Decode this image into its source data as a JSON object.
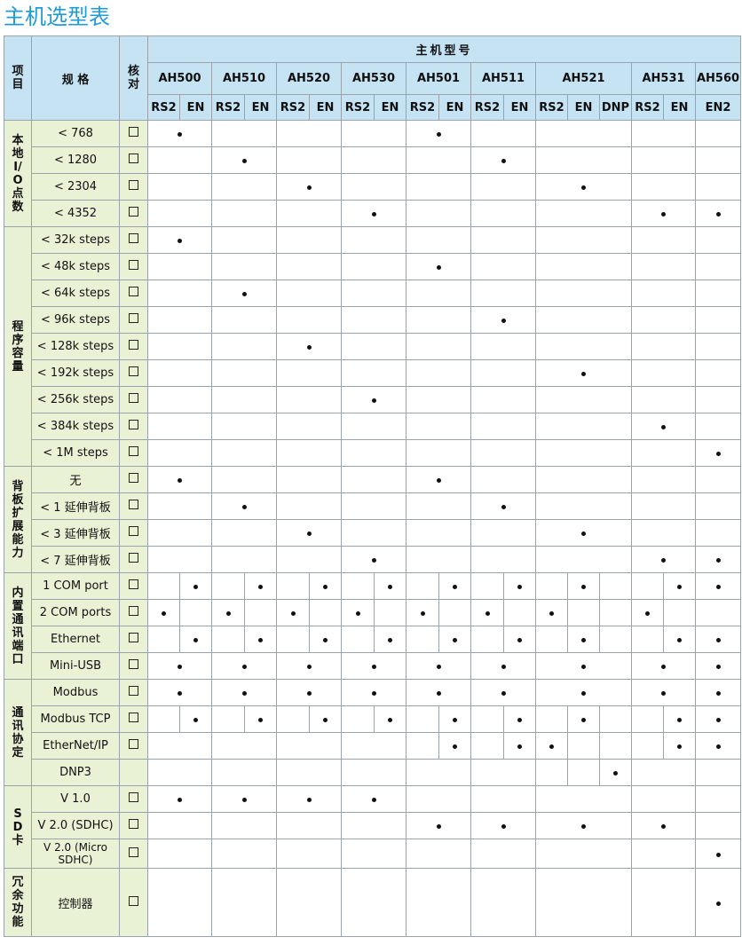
{
  "title": "主机选型表",
  "header": {
    "item": "项目",
    "spec": "规 格",
    "check": "核对",
    "models_title": "主机型号",
    "models": [
      "AH500",
      "AH510",
      "AH520",
      "AH530",
      "AH501",
      "AH511",
      "AH521",
      "AH531",
      "AH560"
    ]
  },
  "sub_columns": [
    "RS2",
    "EN",
    "RS2",
    "EN",
    "RS2",
    "EN",
    "RS2",
    "EN",
    "RS2",
    "EN",
    "RS2",
    "EN",
    "RS2",
    "EN",
    "DNP",
    "RS2",
    "EN",
    "EN2"
  ],
  "categories": [
    {
      "label": "本地I/O点数",
      "rows": [
        {
          "spec": "< 768",
          "checkbox": true,
          "marks": [
            1,
            0,
            0,
            0,
            0,
            0,
            0,
            0,
            1,
            0,
            0,
            0,
            0,
            0,
            0,
            0,
            0,
            0
          ]
        },
        {
          "spec": "< 1280",
          "checkbox": true,
          "marks": [
            0,
            0,
            1,
            0,
            0,
            0,
            0,
            0,
            0,
            0,
            1,
            0,
            0,
            0,
            0,
            0,
            0,
            0
          ]
        },
        {
          "spec": "< 2304",
          "checkbox": true,
          "marks": [
            0,
            0,
            0,
            0,
            1,
            0,
            0,
            0,
            0,
            0,
            0,
            0,
            1,
            0,
            0,
            0,
            0,
            0
          ]
        },
        {
          "spec": "< 4352",
          "checkbox": true,
          "marks": [
            0,
            0,
            0,
            0,
            0,
            0,
            1,
            0,
            0,
            0,
            0,
            0,
            0,
            0,
            0,
            1,
            0,
            1
          ]
        }
      ]
    },
    {
      "label": "程序容量",
      "rows": [
        {
          "spec": "< 32k steps",
          "checkbox": true,
          "marks": [
            1,
            0,
            0,
            0,
            0,
            0,
            0,
            0,
            0,
            0,
            0,
            0,
            0,
            0,
            0,
            0,
            0,
            0
          ]
        },
        {
          "spec": "< 48k steps",
          "checkbox": true,
          "marks": [
            0,
            0,
            0,
            0,
            0,
            0,
            0,
            0,
            1,
            0,
            0,
            0,
            0,
            0,
            0,
            0,
            0,
            0
          ]
        },
        {
          "spec": "< 64k steps",
          "checkbox": true,
          "marks": [
            0,
            0,
            1,
            0,
            0,
            0,
            0,
            0,
            0,
            0,
            0,
            0,
            0,
            0,
            0,
            0,
            0,
            0
          ]
        },
        {
          "spec": "< 96k steps",
          "checkbox": true,
          "marks": [
            0,
            0,
            0,
            0,
            0,
            0,
            0,
            0,
            0,
            0,
            1,
            0,
            0,
            0,
            0,
            0,
            0,
            0
          ]
        },
        {
          "spec": "< 128k steps",
          "checkbox": true,
          "marks": [
            0,
            0,
            0,
            0,
            1,
            0,
            0,
            0,
            0,
            0,
            0,
            0,
            0,
            0,
            0,
            0,
            0,
            0
          ]
        },
        {
          "spec": "< 192k steps",
          "checkbox": true,
          "marks": [
            0,
            0,
            0,
            0,
            0,
            0,
            0,
            0,
            0,
            0,
            0,
            0,
            1,
            0,
            0,
            0,
            0,
            0
          ]
        },
        {
          "spec": "< 256k steps",
          "checkbox": true,
          "marks": [
            0,
            0,
            0,
            0,
            0,
            0,
            1,
            0,
            0,
            0,
            0,
            0,
            0,
            0,
            0,
            0,
            0,
            0
          ]
        },
        {
          "spec": "< 384k steps",
          "checkbox": true,
          "marks": [
            0,
            0,
            0,
            0,
            0,
            0,
            0,
            0,
            0,
            0,
            0,
            0,
            0,
            0,
            0,
            1,
            0,
            0
          ]
        },
        {
          "spec": "< 1M steps",
          "checkbox": true,
          "marks": [
            0,
            0,
            0,
            0,
            0,
            0,
            0,
            0,
            0,
            0,
            0,
            0,
            0,
            0,
            0,
            0,
            0,
            1
          ]
        }
      ]
    },
    {
      "label": "背板扩展能力",
      "rows": [
        {
          "spec": "无",
          "checkbox": true,
          "marks": [
            1,
            0,
            0,
            0,
            0,
            0,
            0,
            0,
            1,
            0,
            0,
            0,
            0,
            0,
            0,
            0,
            0,
            0
          ]
        },
        {
          "spec": "< 1 延伸背板",
          "checkbox": true,
          "marks": [
            0,
            0,
            1,
            0,
            0,
            0,
            0,
            0,
            0,
            0,
            1,
            0,
            0,
            0,
            0,
            0,
            0,
            0
          ]
        },
        {
          "spec": "< 3 延伸背板",
          "checkbox": true,
          "marks": [
            0,
            0,
            0,
            0,
            1,
            0,
            0,
            0,
            0,
            0,
            0,
            0,
            1,
            0,
            0,
            0,
            0,
            0
          ]
        },
        {
          "spec": "< 7 延伸背板",
          "checkbox": true,
          "marks": [
            0,
            0,
            0,
            0,
            0,
            0,
            1,
            0,
            0,
            0,
            0,
            0,
            0,
            0,
            0,
            1,
            0,
            1
          ]
        }
      ]
    },
    {
      "label": "内置通讯端口",
      "rows": [
        {
          "spec": "1 COM port",
          "checkbox": true,
          "marks": [
            0,
            1,
            0,
            1,
            0,
            1,
            0,
            1,
            0,
            1,
            0,
            1,
            0,
            1,
            0,
            0,
            1,
            1
          ]
        },
        {
          "spec": "2 COM ports",
          "checkbox": true,
          "marks": [
            1,
            0,
            1,
            0,
            1,
            0,
            1,
            0,
            1,
            0,
            1,
            0,
            1,
            0,
            0,
            1,
            0,
            0
          ]
        },
        {
          "spec": "Ethernet",
          "checkbox": true,
          "marks": [
            0,
            1,
            0,
            1,
            0,
            1,
            0,
            1,
            0,
            1,
            0,
            1,
            0,
            1,
            0,
            0,
            1,
            1
          ]
        },
        {
          "spec": "Mini-USB",
          "checkbox": true,
          "marks": [
            1,
            0,
            1,
            0,
            1,
            0,
            1,
            0,
            1,
            0,
            1,
            0,
            1,
            0,
            0,
            1,
            0,
            1
          ]
        }
      ]
    },
    {
      "label": "通讯协定",
      "rows": [
        {
          "spec": "Modbus",
          "checkbox": true,
          "marks": [
            1,
            0,
            1,
            0,
            1,
            0,
            1,
            0,
            1,
            0,
            1,
            0,
            1,
            0,
            0,
            1,
            0,
            1
          ]
        },
        {
          "spec": "Modbus TCP",
          "checkbox": true,
          "marks": [
            0,
            1,
            0,
            1,
            0,
            1,
            0,
            1,
            0,
            1,
            0,
            1,
            0,
            1,
            0,
            0,
            1,
            1
          ]
        },
        {
          "spec": "EtherNet/IP",
          "checkbox": true,
          "marks": [
            0,
            0,
            0,
            0,
            0,
            0,
            0,
            0,
            0,
            1,
            0,
            1,
            1,
            0,
            0,
            0,
            1,
            1
          ]
        },
        {
          "spec": "DNP3",
          "checkbox": false,
          "marks": [
            0,
            0,
            0,
            0,
            0,
            0,
            0,
            0,
            0,
            0,
            0,
            0,
            0,
            0,
            1,
            0,
            0,
            0
          ]
        }
      ]
    },
    {
      "label": "SD卡",
      "rows": [
        {
          "spec": "V 1.0",
          "checkbox": true,
          "marks": [
            1,
            0,
            1,
            0,
            1,
            0,
            1,
            0,
            0,
            0,
            0,
            0,
            0,
            0,
            0,
            0,
            0,
            0
          ]
        },
        {
          "spec": "V 2.0 (SDHC)",
          "checkbox": true,
          "marks": [
            0,
            0,
            0,
            0,
            0,
            0,
            0,
            0,
            1,
            0,
            1,
            0,
            1,
            0,
            0,
            1,
            0,
            0
          ]
        },
        {
          "spec": "V 2.0 (Micro SDHC)",
          "checkbox": true,
          "marks": [
            0,
            0,
            0,
            0,
            0,
            0,
            0,
            0,
            0,
            0,
            0,
            0,
            0,
            0,
            0,
            0,
            0,
            1
          ]
        }
      ]
    },
    {
      "label": "冗余功能",
      "rows": [
        {
          "spec": "控制器",
          "checkbox": true,
          "marks": [
            0,
            0,
            0,
            0,
            0,
            0,
            0,
            0,
            0,
            0,
            0,
            0,
            0,
            0,
            0,
            0,
            0,
            1
          ]
        }
      ]
    }
  ]
}
